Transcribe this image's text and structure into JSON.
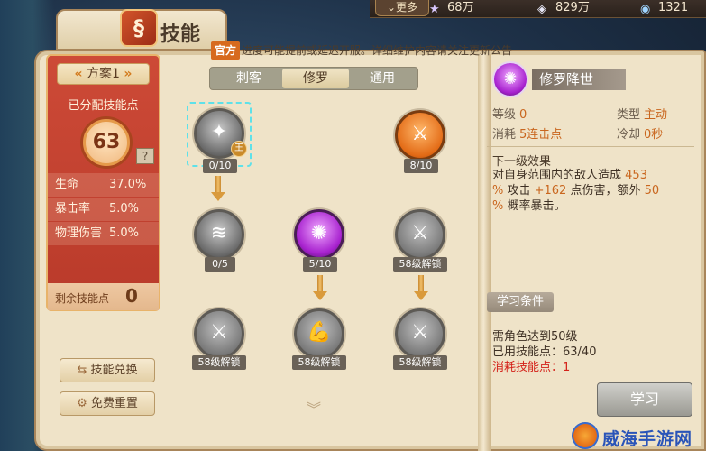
{
  "topbar": {
    "more_label": "更多",
    "resources": [
      {
        "icon": "star-icon",
        "value": "68万",
        "color": "#d9c8ff"
      },
      {
        "icon": "gem-icon",
        "value": "829万",
        "color": "#e8e8f8"
      },
      {
        "icon": "crystal-icon",
        "value": "1321",
        "color": "#9fd4ff"
      }
    ]
  },
  "title": {
    "icon": "skill-book-icon",
    "text": "技能"
  },
  "notice": {
    "badge": "官方",
    "text": "进度可能提前或延迟开服。详细维护内容请关注更新公告"
  },
  "left_panel": {
    "plan_label": "方案1",
    "assigned_label": "已分配技能点",
    "assigned_points": "63",
    "help": "?",
    "stats": [
      {
        "key": "生命",
        "value": "37.0%"
      },
      {
        "key": "暴击率",
        "value": "5.0%"
      },
      {
        "key": "物理伤害",
        "value": "5.0%"
      }
    ],
    "remaining_label": "剩余技能点",
    "remaining_value": "0"
  },
  "buttons": {
    "exchange": "技能兑换",
    "reset": "免费重置"
  },
  "tabs": [
    {
      "label": "刺客",
      "active": false
    },
    {
      "label": "修罗",
      "active": true
    },
    {
      "label": "通用",
      "active": false
    }
  ],
  "nodes": [
    {
      "name": "skill-node-xiuluo-jiangshi",
      "caption": "0/10",
      "style": "grey",
      "glyph": "✦",
      "selected": true,
      "badge": "王"
    },
    {
      "name": "skill-node-orange",
      "caption": "8/10",
      "style": "orange",
      "glyph": "⚔"
    },
    {
      "name": "skill-node-wind",
      "caption": "0/5",
      "style": "grey",
      "glyph": "≋"
    },
    {
      "name": "skill-node-purple",
      "caption": "5/10",
      "style": "purple",
      "glyph": "✺"
    },
    {
      "name": "skill-node-locked-1",
      "caption": "58级解锁",
      "style": "locked",
      "glyph": "⚔"
    },
    {
      "name": "skill-node-locked-2",
      "caption": "58级解锁",
      "style": "locked",
      "glyph": "⚔"
    },
    {
      "name": "skill-node-locked-3",
      "caption": "58级解锁",
      "style": "locked",
      "glyph": "💪"
    },
    {
      "name": "skill-node-locked-4",
      "caption": "58级解锁",
      "style": "locked",
      "glyph": "⚔"
    }
  ],
  "detail": {
    "icon": "purple-skill-icon",
    "name": "修罗降世",
    "level_label": "等级",
    "level_value": "0",
    "type_label": "类型",
    "type_value": "主动",
    "cost_label": "消耗",
    "cost_value": "5连击点",
    "cooldown_label": "冷却",
    "cooldown_value": "0秒",
    "next_label": "下一级效果",
    "effect_1": "对自身范围内的敌人造成",
    "effect_2": "453",
    "effect_3": "%",
    "effect_4": " 攻击 ",
    "effect_5": "+162",
    "effect_6": " 点伤害，额外 ",
    "effect_7": "50",
    "effect_8": "%",
    "effect_9": " 概率暴击。",
    "cond_title": "学习条件",
    "cond_1": "需角色达到50级",
    "cond_2": "已用技能点：63/40",
    "cond_3": "消耗技能点：1",
    "learn_label": "学习"
  },
  "watermark": {
    "text": "威海手游网"
  },
  "colors": {
    "accent_orange": "#c9661e",
    "panel_red": "#c5432f",
    "highlight_red": "#d4221a"
  }
}
